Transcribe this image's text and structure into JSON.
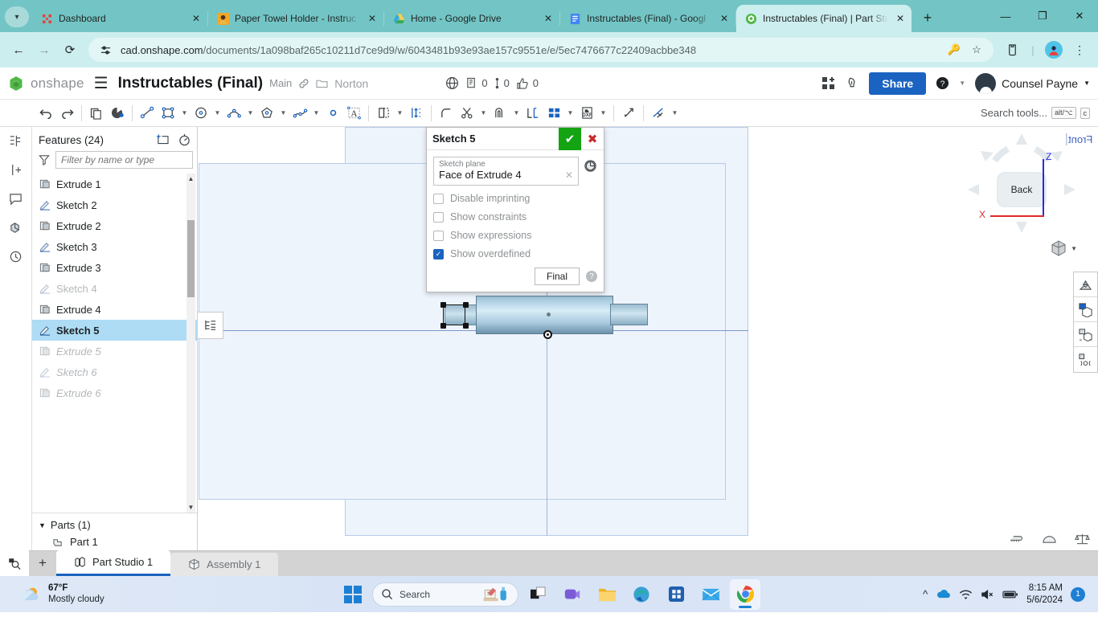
{
  "browser": {
    "tabs": [
      {
        "title": "Dashboard",
        "icon": "onshape-dashboard-icon",
        "active": false
      },
      {
        "title": "Paper Towel Holder - Instruc",
        "icon": "instructables-icon",
        "active": false
      },
      {
        "title": "Home - Google Drive",
        "icon": "google-drive-icon",
        "active": false
      },
      {
        "title": "Instructables (Final) - Googl",
        "icon": "google-docs-icon",
        "active": false
      },
      {
        "title": "Instructables (Final) | Part Stu",
        "icon": "onshape-icon",
        "active": true
      }
    ],
    "new_tab_label": "+",
    "window_controls": {
      "minimize": "—",
      "maximize": "❐",
      "close": "✕"
    },
    "nav": {
      "back": "←",
      "forward": "→",
      "reload": "⟳"
    },
    "url_host": "cad.onshape.com",
    "url_path": "/documents/1a098baf265c10211d7ce9d9/w/6043481b93e93ae157c9551e/e/5ec7476677c22409acbbe348"
  },
  "onshape_header": {
    "brand": "onshape",
    "document_title": "Instructables (Final)",
    "branch": "Main",
    "folder": "Norton",
    "counts": {
      "copies": "0",
      "versions": "0",
      "likes": "0"
    },
    "share_label": "Share",
    "user_name": "Counsel Payne"
  },
  "toolbar": {
    "search_placeholder": "Search tools...",
    "shortcut_alt": "alt/⌥",
    "shortcut_key": "c"
  },
  "features_panel": {
    "title": "Features (24)",
    "filter_placeholder": "Filter by name or type",
    "items": [
      {
        "label": "Extrude 1",
        "type": "extrude",
        "state": "normal"
      },
      {
        "label": "Sketch 2",
        "type": "sketch",
        "state": "normal"
      },
      {
        "label": "Extrude 2",
        "type": "extrude",
        "state": "normal"
      },
      {
        "label": "Sketch 3",
        "type": "sketch",
        "state": "normal"
      },
      {
        "label": "Extrude 3",
        "type": "extrude",
        "state": "normal"
      },
      {
        "label": "Sketch 4",
        "type": "sketch",
        "state": "suppressed"
      },
      {
        "label": "Extrude 4",
        "type": "extrude",
        "state": "normal"
      },
      {
        "label": "Sketch 5",
        "type": "sketch",
        "state": "selected"
      },
      {
        "label": "Extrude 5",
        "type": "extrude",
        "state": "rolledback"
      },
      {
        "label": "Sketch 6",
        "type": "sketch",
        "state": "rolledback"
      },
      {
        "label": "Extrude 6",
        "type": "extrude",
        "state": "rolledback"
      }
    ],
    "parts_title": "Parts (1)",
    "parts": [
      {
        "label": "Part 1"
      }
    ]
  },
  "sketch_dialog": {
    "title": "Sketch 5",
    "accept_icon": "✔",
    "cancel_icon": "✖",
    "plane_label": "Sketch plane",
    "plane_value": "Face of Extrude 4",
    "clear_icon": "✕",
    "options": [
      {
        "label": "Disable imprinting",
        "checked": false
      },
      {
        "label": "Show constraints",
        "checked": false
      },
      {
        "label": "Show expressions",
        "checked": false
      },
      {
        "label": "Show overdefined",
        "checked": true
      }
    ],
    "final_label": "Final",
    "help_label": "?"
  },
  "viewport": {
    "front_label": "Front",
    "viewcube_face": "Back",
    "axis_z": "Z",
    "axis_x": "X"
  },
  "document_tabs": [
    {
      "label": "Part Studio 1",
      "active": true
    },
    {
      "label": "Assembly 1",
      "active": false
    }
  ],
  "taskbar": {
    "weather_temp": "67°F",
    "weather_desc": "Mostly cloudy",
    "search_placeholder": "Search",
    "time": "8:15 AM",
    "date": "5/6/2024",
    "notification_count": "1"
  },
  "colors": {
    "browser_chrome": "#73c5c5",
    "accent_blue": "#1a63c0",
    "selection_blue": "#aedcf5",
    "accept_green": "#13a313",
    "cancel_red": "#c8292b",
    "axis_z": "#2a2ae0",
    "axis_x": "#e02a2a"
  }
}
